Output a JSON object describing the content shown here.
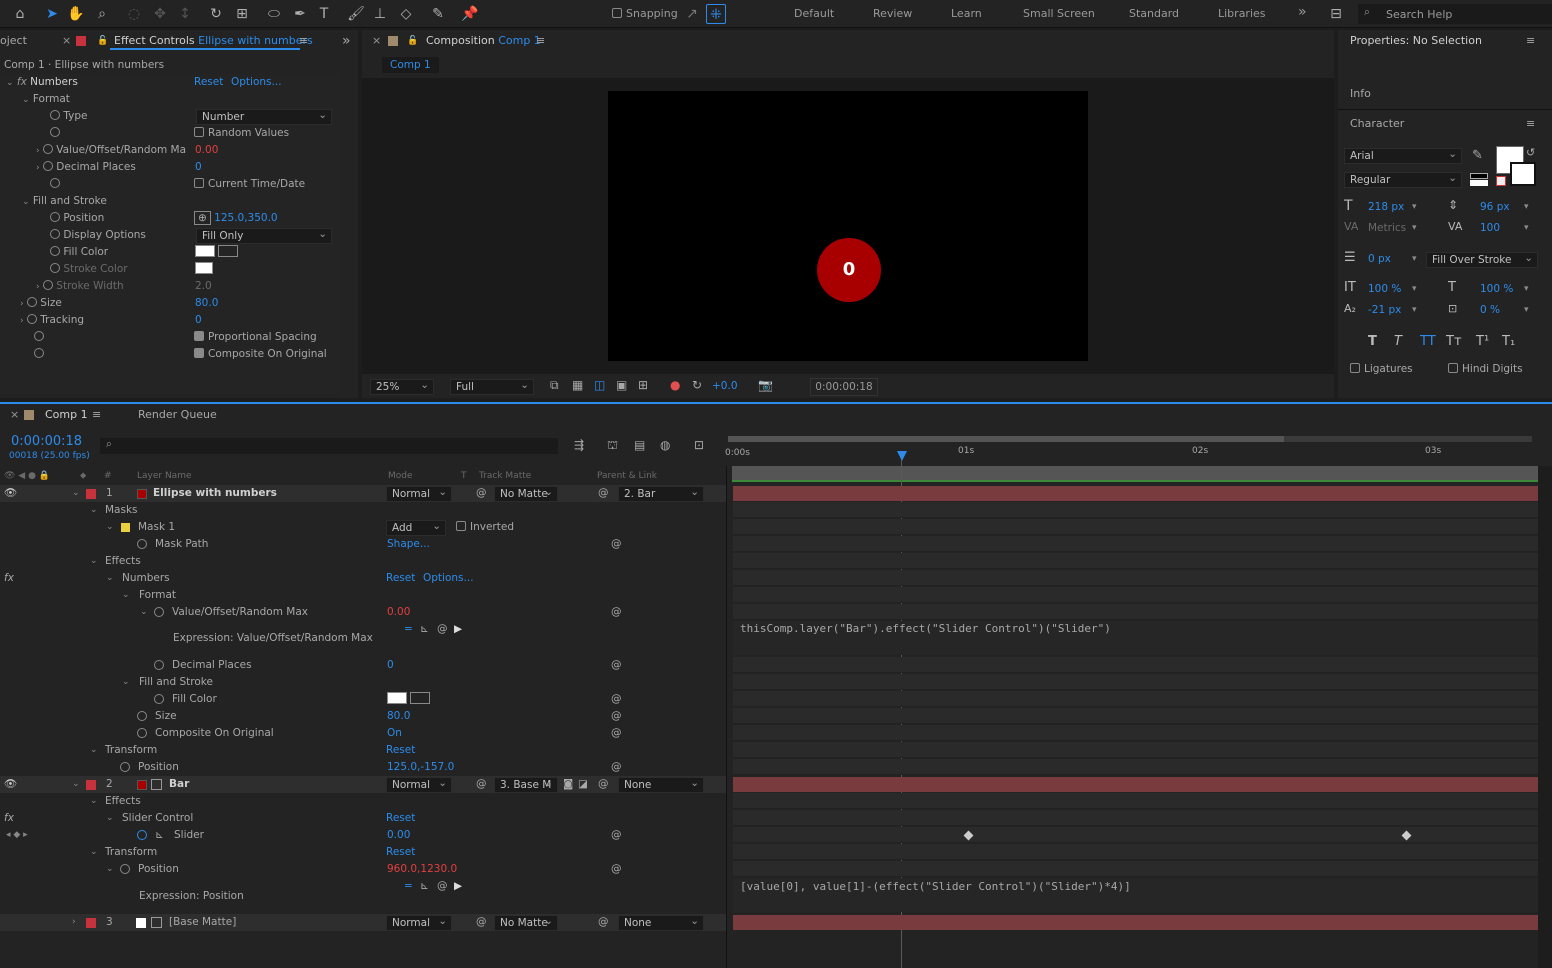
{
  "toolbar": {
    "snapping": "Snapping",
    "workspaces": [
      "Default",
      "Review",
      "Learn",
      "Small Screen",
      "Standard",
      "Libraries"
    ],
    "search_placeholder": "Search Help"
  },
  "effect_controls": {
    "tab_prefix": "oject",
    "tab_label": "Effect Controls",
    "tab_layer": "Ellipse with numbers",
    "subtitle": "Comp 1 · Ellipse with numbers",
    "effect_name": "Numbers",
    "reset": "Reset",
    "options": "Options...",
    "format": "Format",
    "type_label": "Type",
    "type_value": "Number",
    "random_values": "Random Values",
    "value_label": "Value/Offset/Random Ma",
    "value": "0.00",
    "decimal_label": "Decimal Places",
    "decimal_value": "0",
    "current_time": "Current Time/Date",
    "fill_stroke": "Fill and Stroke",
    "position_label": "Position",
    "position_value": "125.0,350.0",
    "display_label": "Display Options",
    "display_value": "Fill Only",
    "fill_color": "Fill Color",
    "stroke_color": "Stroke Color",
    "stroke_width": "Stroke Width",
    "stroke_width_value": "2.0",
    "size_label": "Size",
    "size_value": "80.0",
    "tracking_label": "Tracking",
    "tracking_value": "0",
    "prop_spacing": "Proportional Spacing",
    "composite": "Composite On Original"
  },
  "composition": {
    "tab_label": "Composition",
    "tab_comp": "Comp 1",
    "breadcrumb": "Comp 1",
    "number_display": "0",
    "zoom": "25%",
    "resolution": "Full",
    "exposure": "+0.0",
    "timecode": "0:00:00:18"
  },
  "properties": {
    "title": "Properties: No Selection",
    "info": "Info",
    "character": "Character",
    "font": "Arial",
    "style": "Regular",
    "font_size": "218 px",
    "leading": "96 px",
    "kerning": "Metrics",
    "tracking": "100",
    "stroke": "0 px",
    "stroke_mode": "Fill Over Stroke",
    "vscale": "100 %",
    "hscale": "100 %",
    "baseline": "-21 px",
    "tsume": "0 %",
    "ligatures": "Ligatures",
    "hindi": "Hindi Digits",
    "style_buttons": [
      "T",
      "T",
      "TT",
      "Tт",
      "T¹",
      "T₁"
    ]
  },
  "timeline": {
    "tab_label": "Comp 1",
    "render_queue": "Render Queue",
    "timecode": "0:00:00:18",
    "frames": "00018 (25.00 fps)",
    "cols": {
      "num": "#",
      "layer_name": "Layer Name",
      "mode": "Mode",
      "t": "T",
      "track_matte": "Track Matte",
      "parent": "Parent & Link"
    },
    "ruler": [
      "0:00s",
      "01s",
      "02s",
      "03s"
    ],
    "l1": {
      "num": "1",
      "name": "Ellipse with numbers",
      "mode": "Normal",
      "matte": "No Matte",
      "parent": "2. Bar"
    },
    "masks": "Masks",
    "mask1": "Mask 1",
    "mask_mode": "Add",
    "inverted": "Inverted",
    "mask_path": "Mask Path",
    "shape": "Shape...",
    "effects": "Effects",
    "numbers": "Numbers",
    "reset": "Reset",
    "options": "Options...",
    "format": "Format",
    "value_label": "Value/Offset/Random Max",
    "value": "0.00",
    "expr_label": "Expression: Value/Offset/Random Max",
    "expr1": "thisComp.layer(\"Bar\").effect(\"Slider Control\")(\"Slider\")",
    "decimal_label": "Decimal Places",
    "decimal_value": "0",
    "fill_stroke": "Fill and Stroke",
    "fill_color": "Fill Color",
    "size_label": "Size",
    "size_value": "80.0",
    "composite_label": "Composite On Original",
    "composite_value": "On",
    "transform": "Transform",
    "position_label": "Position",
    "position1": "125.0,-157.0",
    "l2": {
      "num": "2",
      "name": "Bar",
      "mode": "Normal",
      "matte": "3. Base M",
      "parent": "None"
    },
    "slider_control": "Slider Control",
    "slider": "Slider",
    "slider_value": "0.00",
    "position2": "960.0,1230.0",
    "expr_pos_label": "Expression: Position",
    "expr2": "[value[0], value[1]-(effect(\"Slider Control\")(\"Slider\")*4)]",
    "l3": {
      "num": "3",
      "name": "[Base Matte]",
      "mode": "Normal",
      "matte": "No Matte",
      "parent": "None"
    }
  },
  "colors": {
    "accent": "#2d8ceb",
    "label_red": "#c8323c",
    "ellipse": "#a80000"
  }
}
